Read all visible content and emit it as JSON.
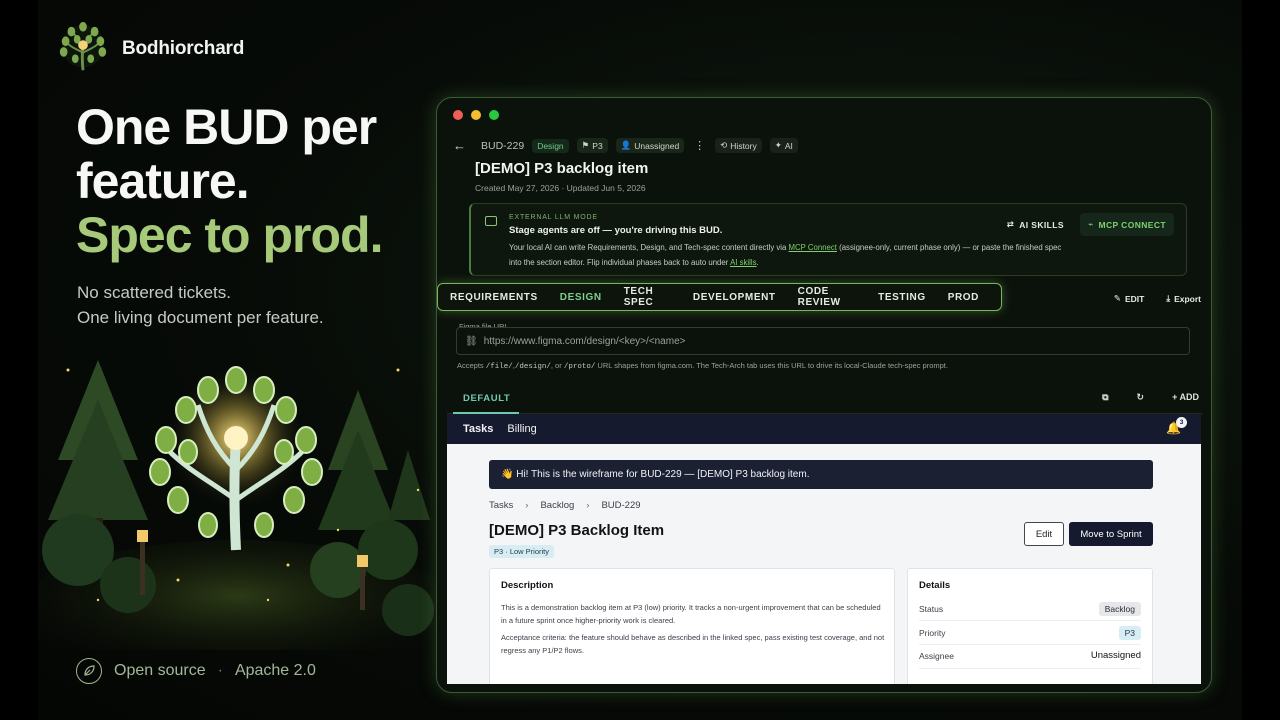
{
  "brand": {
    "name": "Bodhiorchard"
  },
  "hero": {
    "line1": "One BUD per",
    "line2": "feature.",
    "line3": "Spec to prod.",
    "sub1": "No scattered tickets.",
    "sub2": "One living document per feature."
  },
  "footer": {
    "left": "Open source",
    "sep": "·",
    "right": "Apache 2.0"
  },
  "colors": {
    "accent_green": "#a7c97a",
    "active_tab": "#7fcf90",
    "link_green": "#7fcf70",
    "teal_tab": "#6fc9b0",
    "navy": "#161a2e"
  },
  "app": {
    "topbar": {
      "back_icon": "arrow-left-icon",
      "bud_id": "BUD-229",
      "phase_chip": "Design",
      "priority_chip": "P3",
      "assignee_chip": "Unassigned",
      "more_icon": "⋮",
      "history": "History",
      "ai": "AI"
    },
    "title": "[DEMO] P3 backlog item",
    "meta": "Created May 27, 2026 · Updated Jun 5, 2026",
    "llm": {
      "label": "EXTERNAL LLM MODE",
      "headline": "Stage agents are off — you're driving this BUD.",
      "body_1": "Your local AI can write Requirements, Design, and Tech-spec content directly via ",
      "link_1": "MCP Connect",
      "body_2": " (assignee-only, current phase only) — or paste the finished spec into the section editor. Flip individual phases back to auto under ",
      "link_2": "AI skills",
      "body_3": ".",
      "ai_skills": "AI SKILLS",
      "mcp_connect": "MCP CONNECT"
    },
    "phases": [
      "REQUIREMENTS",
      "DESIGN",
      "TECH SPEC",
      "DEVELOPMENT",
      "CODE REVIEW",
      "TESTING",
      "PROD"
    ],
    "active_phase": "DESIGN",
    "edit": "EDIT",
    "export": "Export",
    "figma": {
      "label": "Figma file URL",
      "placeholder": "https://www.figma.com/design/<key>/<name>",
      "hint_1": "Accepts ",
      "hint_code_1": "/file/",
      "hint_comma": ",",
      "hint_code_2": "/design/",
      "hint_or": ", or ",
      "hint_code_3": "/proto/",
      "hint_2": " URL shapes from figma.com. The Tech-Arch tab uses this URL to drive its local-Claude tech-spec prompt."
    },
    "subtab": "DEFAULT",
    "add": "ADD"
  },
  "wireframe": {
    "nav": {
      "tasks": "Tasks",
      "billing": "Billing",
      "badge": "3"
    },
    "banner": "👋 Hi! This is the wireframe for BUD-229 — [DEMO] P3 backlog item.",
    "crumbs": [
      "Tasks",
      "Backlog",
      "BUD-229"
    ],
    "crumb_sep": "›",
    "title": "[DEMO] P3 Backlog Item",
    "badge": "P3 · Low Priority",
    "edit": "Edit",
    "move": "Move to Sprint",
    "description": {
      "heading": "Description",
      "p1": "This is a demonstration backlog item at P3 (low) priority. It tracks a non-urgent improvement that can be scheduled in a future sprint once higher-priority work is cleared.",
      "p2": "Acceptance criteria: the feature should behave as described in the linked spec, pass existing test coverage, and not regress any P1/P2 flows."
    },
    "details": {
      "heading": "Details",
      "status_label": "Status",
      "status_value": "Backlog",
      "priority_label": "Priority",
      "priority_value": "P3",
      "assignee_label": "Assignee",
      "assignee_value": "Unassigned"
    }
  }
}
